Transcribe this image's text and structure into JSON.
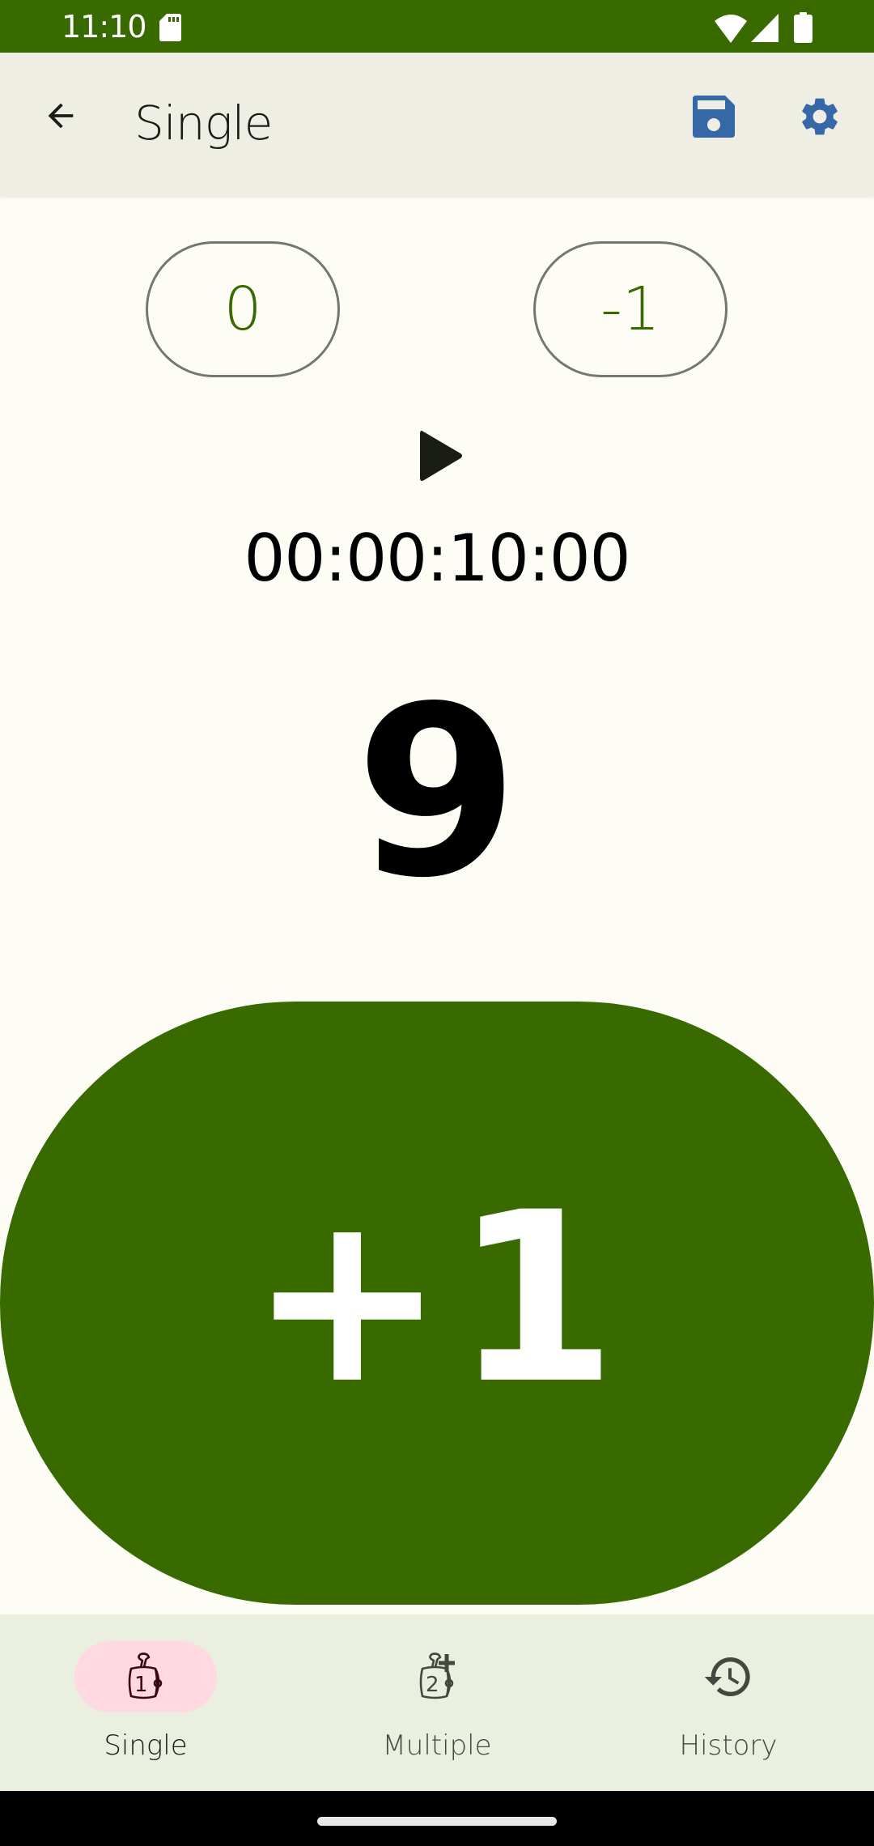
{
  "status_bar": {
    "time": "11:10",
    "icons": [
      "sd-card-icon",
      "wifi-icon",
      "cell-signal-icon",
      "battery-icon"
    ]
  },
  "app_bar": {
    "title": "Single",
    "back_icon": "arrow-back-icon",
    "actions": [
      {
        "name": "save",
        "icon": "floppy-disk-icon"
      },
      {
        "name": "settings",
        "icon": "gear-icon"
      }
    ]
  },
  "counter": {
    "reset_value_label": "0",
    "decrement_label": "-1",
    "play_icon": "play-icon",
    "timer": "00:00:10:00",
    "count": "9",
    "increment_label": "+1"
  },
  "bottom_nav": {
    "items": [
      {
        "label": "Single",
        "icon": "single-counter-icon",
        "active": true
      },
      {
        "label": "Multiple",
        "icon": "multiple-counter-icon",
        "active": false
      },
      {
        "label": "History",
        "icon": "history-icon",
        "active": false
      }
    ]
  },
  "colors": {
    "primary": "#386a00",
    "action_icon": "#3667a6",
    "nav_indicator": "#ffd9e2",
    "app_bar_bg": "#eeeee4",
    "background": "#fdfdf5"
  }
}
